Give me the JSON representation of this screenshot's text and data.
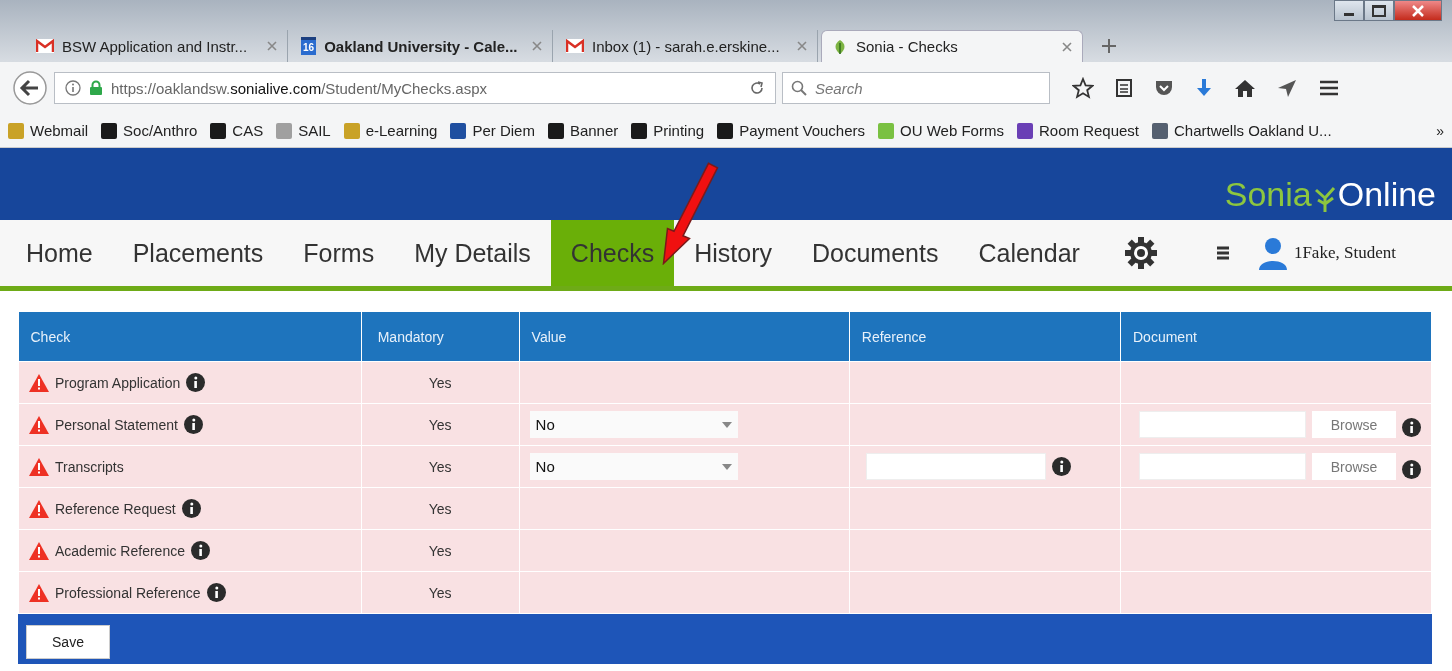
{
  "browser": {
    "tabs": [
      {
        "title": "BSW Application and Instr...",
        "kind": "mail",
        "selected": false,
        "unread": false
      },
      {
        "title": "Oakland University - Cale...",
        "kind": "calendar",
        "favicon_text": "16",
        "selected": false,
        "unread": true
      },
      {
        "title": "Inbox (1) - sarah.e.erskine...",
        "kind": "mail",
        "selected": false,
        "unread": false
      },
      {
        "title": "Sonia - Checks",
        "kind": "leaf",
        "selected": true,
        "unread": false
      }
    ],
    "address": {
      "url": "https://oaklandsw.**sonialive.com**/Student/MyChecks.aspx"
    },
    "search": {
      "placeholder": "Search"
    },
    "bookmarks": [
      {
        "label": "Webmail",
        "kind": "ou"
      },
      {
        "label": "Soc/Anthro",
        "kind": "ou-dark"
      },
      {
        "label": "CAS",
        "kind": "ou-dark"
      },
      {
        "label": "SAIL",
        "kind": "sail"
      },
      {
        "label": "e-Learning",
        "kind": "ou"
      },
      {
        "label": "Per Diem",
        "kind": "gsa"
      },
      {
        "label": "Banner",
        "kind": "ou-dark"
      },
      {
        "label": "Printing",
        "kind": "ou-dark"
      },
      {
        "label": "Payment Vouchers",
        "kind": "ou-dark"
      },
      {
        "label": "OU Web Forms",
        "kind": "thumb"
      },
      {
        "label": "Room Request",
        "kind": "form"
      },
      {
        "label": "Chartwells Oakland U...",
        "kind": "building"
      }
    ],
    "bookmarks_overflow": "»"
  },
  "app": {
    "logo": {
      "part_1": "Sonia",
      "part_2": "Online"
    },
    "nav": [
      {
        "label": "Home",
        "selected": false
      },
      {
        "label": "Placements",
        "selected": false
      },
      {
        "label": "Forms",
        "selected": false
      },
      {
        "label": "My Details",
        "selected": false
      },
      {
        "label": "Checks",
        "selected": true
      },
      {
        "label": "History",
        "selected": false
      },
      {
        "label": "Documents",
        "selected": false
      },
      {
        "label": "Calendar",
        "selected": false
      }
    ],
    "user": "1Fake, Student",
    "table": {
      "columns": [
        "Check",
        "Mandatory",
        "Value",
        "Reference",
        "Document"
      ],
      "rows": [
        {
          "check": "Program Application",
          "kind": "warning",
          "info": true,
          "mandatory": "Yes",
          "reference_input": false,
          "reference_info": false,
          "document_info": false
        },
        {
          "check": "Personal Statement",
          "kind": "warning",
          "info": true,
          "mandatory": "Yes",
          "value": "No",
          "reference_input": false,
          "reference_info": false,
          "document_button": "Browse",
          "document_info": true
        },
        {
          "check": "Transcripts",
          "kind": "warning",
          "info": false,
          "mandatory": "Yes",
          "value": "No",
          "reference_input": true,
          "reference_info": true,
          "document_button": "Browse",
          "document_info": true
        },
        {
          "check": "Reference Request",
          "kind": "warning",
          "info": true,
          "mandatory": "Yes",
          "reference_input": false,
          "reference_info": false,
          "document_info": false
        },
        {
          "check": "Academic Reference",
          "kind": "warning",
          "info": true,
          "mandatory": "Yes",
          "reference_input": false,
          "reference_info": false,
          "document_info": false
        },
        {
          "check": "Professional Reference",
          "kind": "warning",
          "info": true,
          "mandatory": "Yes",
          "reference_input": false,
          "reference_info": false,
          "document_info": false
        }
      ]
    },
    "save": "Save"
  }
}
